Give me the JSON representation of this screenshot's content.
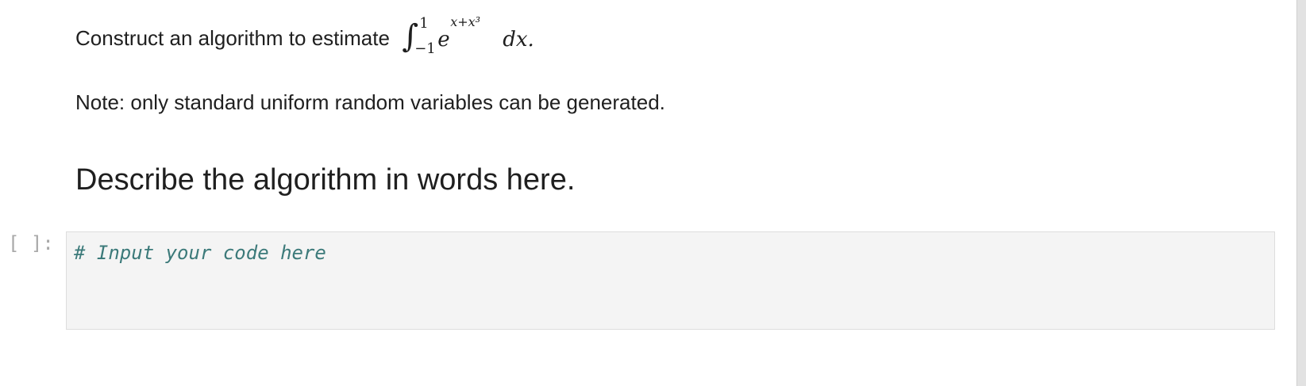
{
  "markdown": {
    "prompt_text": "Construct an algorithm to estimate",
    "math": {
      "integral_sign": "∫",
      "upper_limit": "1",
      "lower_limit": "−1",
      "base": "e",
      "exponent": "x+x³",
      "differential": "dx."
    },
    "note": "Note: only standard uniform random variables can be generated.",
    "heading": "Describe the algorithm in words here."
  },
  "code_cell": {
    "prompt": "[ ]:",
    "code": "# Input your code here"
  },
  "colors": {
    "code_comment": "#3c7a7a",
    "prompt": "#a8a8a8",
    "cell_background": "#f4f4f4",
    "cell_border": "#dddddd"
  }
}
